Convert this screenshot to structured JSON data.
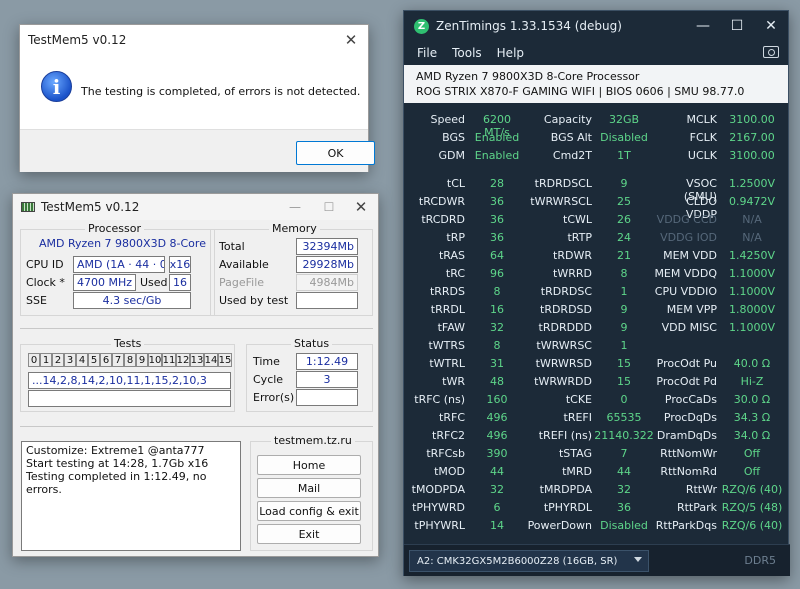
{
  "dialog": {
    "title": "TestMem5 v0.12",
    "message": "The testing is completed, of errors is not detected.",
    "ok_label": "OK"
  },
  "testmem": {
    "title": "TestMem5 v0.12",
    "processor": {
      "group": "Processor",
      "name": "AMD Ryzen 7 9800X3D 8-Core",
      "cpu_id_label": "CPU ID",
      "cpu_id_value": "AMD  (1A · 44 · 0)",
      "threads": "x16",
      "clock_label": "Clock *",
      "clock_value": "4700 MHz",
      "used_label": "Used",
      "used_value": "16",
      "sse_label": "SSE",
      "sse_value": "4.3 sec/Gb"
    },
    "memory": {
      "group": "Memory",
      "total_label": "Total",
      "total_value": "32394Mb",
      "available_label": "Available",
      "available_value": "29928Mb",
      "pagefile_label": "PageFile",
      "pagefile_value": "4984Mb",
      "usedbytest_label": "Used by test",
      "usedbytest_value": ""
    },
    "tests": {
      "group": "Tests",
      "cells": [
        "0",
        "1",
        "2",
        "3",
        "4",
        "5",
        "6",
        "7",
        "8",
        "9",
        "10",
        "11",
        "12",
        "13",
        "14",
        "15"
      ],
      "sequence": "...14,2,8,14,2,10,11,1,15,2,10,3"
    },
    "status": {
      "group": "Status",
      "time_label": "Time",
      "time_value": "1:12.49",
      "cycle_label": "Cycle",
      "cycle_value": "3",
      "errors_label": "Error(s)",
      "errors_value": ""
    },
    "log": {
      "line1": "Customize: Extreme1 @anta777",
      "line2": "Start testing at 14:28, 1.7Gb x16",
      "line3": "Testing completed in 1:12.49, no errors."
    },
    "site": {
      "group": "testmem.tz.ru",
      "home": "Home",
      "mail": "Mail",
      "load": "Load config & exit",
      "exit": "Exit"
    }
  },
  "zentimings": {
    "title": "ZenTimings 1.33.1534 (debug)",
    "menu": {
      "file": "File",
      "tools": "Tools",
      "help": "Help"
    },
    "cpu": "AMD Ryzen 7 9800X3D 8-Core Processor",
    "board": "ROG STRIX X870-F GAMING WIFI | BIOS 0606 | SMU 98.77.0",
    "header_rows": [
      [
        "Speed",
        "6200 MT/s",
        "Capacity",
        "32GB",
        "MCLK",
        "3100.00"
      ],
      [
        "BGS",
        "Enabled",
        "BGS Alt",
        "Disabled",
        "FCLK",
        "2167.00"
      ],
      [
        "GDM",
        "Enabled",
        "Cmd2T",
        "1T",
        "UCLK",
        "3100.00"
      ]
    ],
    "rows": [
      [
        "tCL",
        "28",
        "tRDRDSCL",
        "9",
        "VSOC (SMU)",
        "1.2500V"
      ],
      [
        "tRCDWR",
        "36",
        "tWRWRSCL",
        "25",
        "CLDO VDDP",
        "0.9472V"
      ],
      [
        "tRCDRD",
        "36",
        "tCWL",
        "26",
        "VDDG CCD",
        "N/A"
      ],
      [
        "tRP",
        "36",
        "tRTP",
        "24",
        "VDDG IOD",
        "N/A"
      ],
      [
        "tRAS",
        "64",
        "tRDWR",
        "21",
        "MEM VDD",
        "1.4250V"
      ],
      [
        "tRC",
        "96",
        "tWRRD",
        "8",
        "MEM VDDQ",
        "1.1000V"
      ],
      [
        "tRRDS",
        "8",
        "tRDRDSC",
        "1",
        "CPU VDDIO",
        "1.1000V"
      ],
      [
        "tRRDL",
        "16",
        "tRDRDSD",
        "9",
        "MEM VPP",
        "1.8000V"
      ],
      [
        "tFAW",
        "32",
        "tRDRDDD",
        "9",
        "VDD MISC",
        "1.1000V"
      ],
      [
        "tWTRS",
        "8",
        "tWRWRSC",
        "1",
        "",
        ""
      ],
      [
        "tWTRL",
        "31",
        "tWRWRSD",
        "15",
        "ProcOdt Pu",
        "40.0 Ω"
      ],
      [
        "tWR",
        "48",
        "tWRWRDD",
        "15",
        "ProcOdt Pd",
        "Hi-Z"
      ],
      [
        "tRFC (ns)",
        "160",
        "tCKE",
        "0",
        "ProcCaDs",
        "30.0 Ω"
      ],
      [
        "tRFC",
        "496",
        "tREFI",
        "65535",
        "ProcDqDs",
        "34.3 Ω"
      ],
      [
        "tRFC2",
        "496",
        "tREFI (ns)",
        "21140.322",
        "DramDqDs",
        "34.0 Ω"
      ],
      [
        "tRFCsb",
        "390",
        "tSTAG",
        "7",
        "RttNomWr",
        "Off"
      ],
      [
        "tMOD",
        "44",
        "tMRD",
        "44",
        "RttNomRd",
        "Off"
      ],
      [
        "tMODPDA",
        "32",
        "tMRDPDA",
        "32",
        "RttWr",
        "RZQ/6 (40)"
      ],
      [
        "tPHYWRD",
        "6",
        "tPHYRDL",
        "36",
        "RttPark",
        "RZQ/5 (48)"
      ],
      [
        "tPHYWRL",
        "14",
        "PowerDown",
        "Disabled",
        "RttParkDqs",
        "RZQ/6 (40)"
      ]
    ],
    "dimmed_labels": [
      "VDDG CCD",
      "VDDG IOD"
    ],
    "dimm_select": "A2: CMK32GX5M2B6000Z28 (16GB, SR)",
    "mem_type": "DDR5",
    "colors": {
      "value": "#5ed68a",
      "label": "#e6eef5",
      "bg": "#1c2a38"
    }
  }
}
